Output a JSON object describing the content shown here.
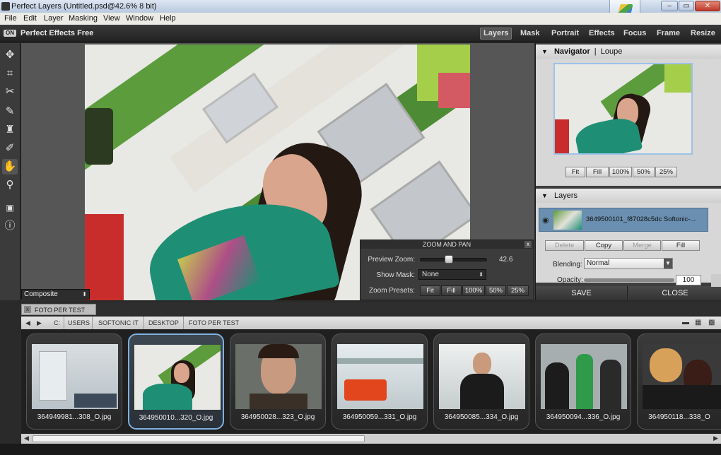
{
  "window": {
    "title": "Perfect Layers (Untitled.psd@42.6% 8 bit)",
    "minimize": "–",
    "maximize": "▭",
    "close": "✕"
  },
  "menu": [
    "File",
    "Edit",
    "Layer",
    "Masking",
    "View",
    "Window",
    "Help"
  ],
  "app": {
    "logo": "ON",
    "name": "Perfect Effects Free"
  },
  "modules": [
    "Layers",
    "Mask",
    "Portrait",
    "Effects",
    "Focus",
    "Frame",
    "Resize"
  ],
  "active_module": "Layers",
  "tools": [
    "move-icon",
    "crop-icon",
    "scissors-icon",
    "brush-icon",
    "stamp-icon",
    "retouch-brush-icon",
    "hand-icon",
    "zoom-icon",
    "compare-icon",
    "info-icon"
  ],
  "canvas": {
    "blend_select": "Composite"
  },
  "zoom_pan": {
    "title": "ZOOM AND PAN",
    "preview_zoom_label": "Preview Zoom:",
    "zoom_value": "42.6",
    "zoom_level": 0.43,
    "show_mask_label": "Show Mask:",
    "show_mask_value": "None",
    "presets_label": "Zoom Presets:",
    "presets": [
      "Fit",
      "Fill",
      "100%",
      "50%",
      "25%"
    ]
  },
  "navigator": {
    "title": "Navigator",
    "separator": "|",
    "alt_tab": "Loupe",
    "buttons": [
      "Fit",
      "Fill",
      "100%",
      "50%",
      "25%"
    ]
  },
  "layers": {
    "title": "Layers",
    "layer_name": "3649500101_f87028c5dc Softonic-...",
    "buttons": [
      "Delete",
      "Copy",
      "Merge",
      "Fill"
    ],
    "blending_label": "Blending:",
    "blending_value": "Normal",
    "opacity_label": "Opacity:",
    "opacity_value": "100"
  },
  "actions": {
    "save": "SAVE",
    "close": "CLOSE"
  },
  "browser": {
    "tab": "FOTO PER TEST",
    "path": [
      "C:",
      "USERS",
      "SOFTONIC IT",
      "DESKTOP",
      "FOTO PER TEST"
    ],
    "thumbnails": [
      {
        "caption": "364949981...308_O.jpg"
      },
      {
        "caption": "364950010...320_O.jpg",
        "selected": true
      },
      {
        "caption": "364950028...323_O.jpg"
      },
      {
        "caption": "364950059...331_O.jpg"
      },
      {
        "caption": "364950085...334_O.jpg"
      },
      {
        "caption": "364950094...336_O.jpg"
      },
      {
        "caption": "364950118...338_O"
      }
    ]
  },
  "colors": {
    "accent_selected": "#7fb0e0",
    "panel_bg": "#3e3e3e",
    "titlebar": "#c9d6e8"
  }
}
